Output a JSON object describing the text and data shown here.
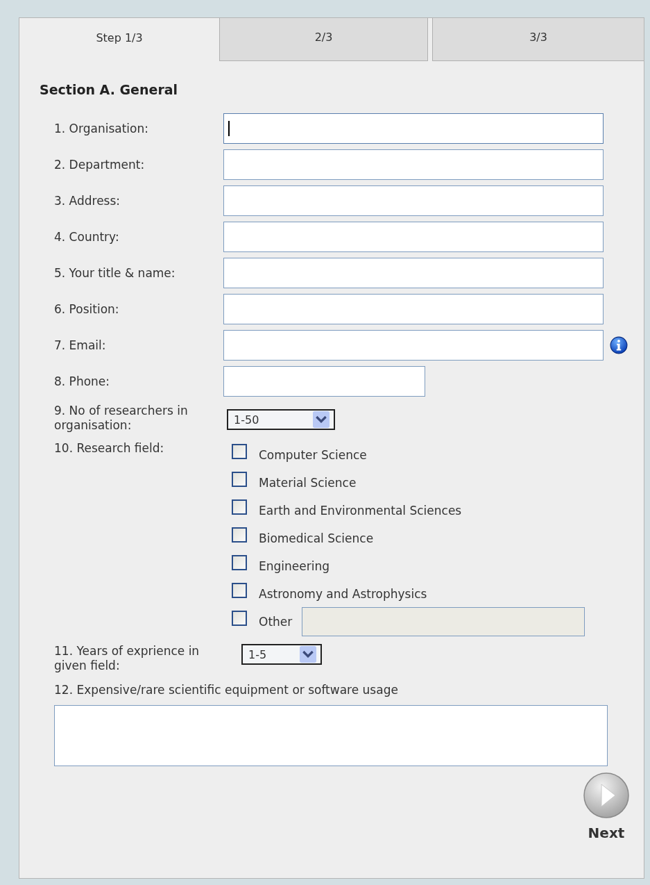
{
  "tabs": [
    {
      "label": "Step 1/3",
      "selected": true
    },
    {
      "label": "2/3",
      "selected": false
    },
    {
      "label": "3/3",
      "selected": false
    }
  ],
  "section_title": "Section A. General",
  "fields": [
    {
      "label": "1. Organisation:",
      "kind": "text",
      "focused": true
    },
    {
      "label": "2. Department:",
      "kind": "text",
      "focused": false
    },
    {
      "label": "3. Address:",
      "kind": "text",
      "focused": false
    },
    {
      "label": "4. Country:",
      "kind": "text",
      "focused": false
    },
    {
      "label": "5. Your title & name:",
      "kind": "text",
      "focused": false
    },
    {
      "label": "6. Position:",
      "kind": "text",
      "focused": false
    },
    {
      "label": "7. Email:",
      "kind": "info",
      "focused": false
    },
    {
      "label": "8. Phone:",
      "kind": "short",
      "focused": false
    },
    {
      "label": "9. No of researchers in organisation:",
      "kind": "select",
      "value": "1-50"
    }
  ],
  "research_field": {
    "label": "10. Research field:",
    "options": [
      {
        "label": "Computer Science",
        "checked": false,
        "kind": "plain"
      },
      {
        "label": "Material Science",
        "checked": false,
        "kind": "plain"
      },
      {
        "label": "Earth and Environmental Sciences",
        "checked": false,
        "kind": "plain"
      },
      {
        "label": "Biomedical Science",
        "checked": false,
        "kind": "plain"
      },
      {
        "label": "Engineering",
        "checked": false,
        "kind": "plain"
      },
      {
        "label": "Astronomy and Astrophysics",
        "checked": false,
        "kind": "plain"
      },
      {
        "label": "Other",
        "checked": false,
        "kind": "other"
      }
    ]
  },
  "experience": {
    "label": "11. Years of exprience in given field:",
    "value": "1-5"
  },
  "equipment": {
    "label": "12. Expensive/rare scientific equipment or software usage"
  },
  "next_button": {
    "label": "Next"
  }
}
